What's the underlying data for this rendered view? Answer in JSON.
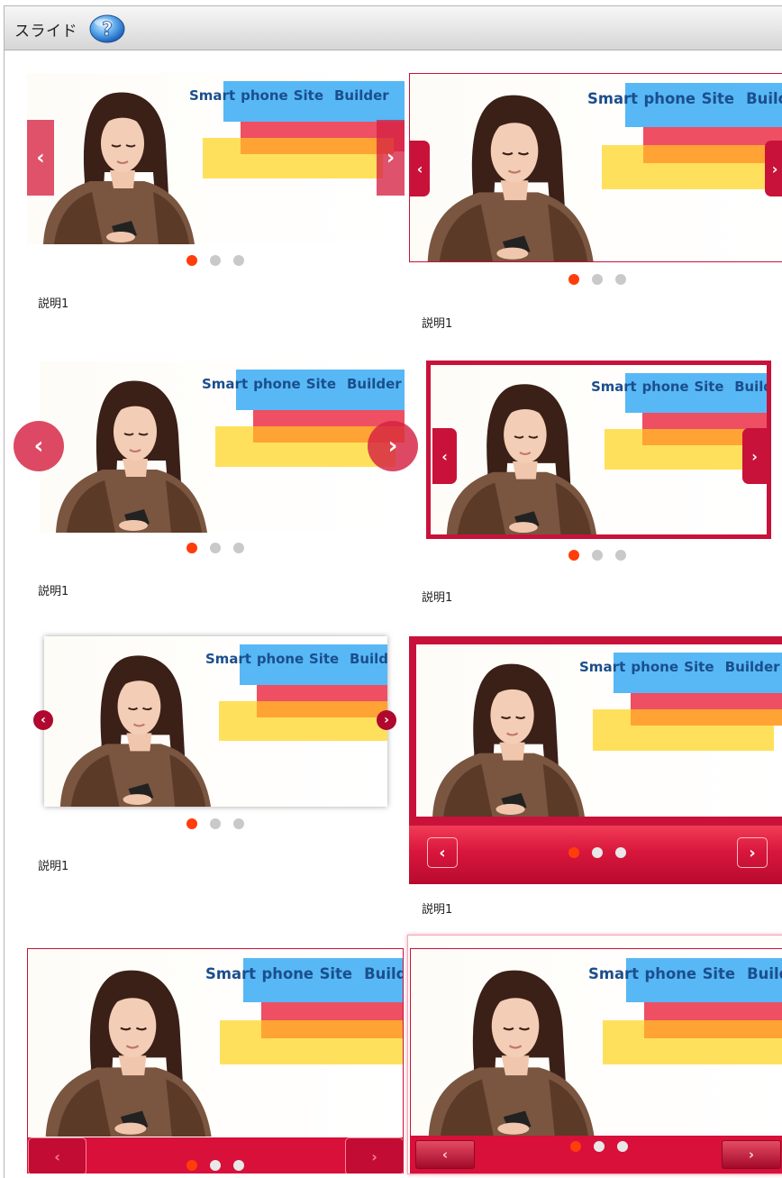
{
  "header": {
    "title": "スライド"
  },
  "slide_brand": {
    "w1": "Smart",
    "w2": "phone",
    "w3": "Site",
    "w4": "Builder"
  },
  "slides": [
    {
      "caption": "説明1",
      "active_dot": 1,
      "dot_count": 3,
      "prev_label": "‹",
      "next_label": "›"
    },
    {
      "caption": "説明1",
      "active_dot": 1,
      "dot_count": 3,
      "prev_label": "‹",
      "next_label": "›"
    },
    {
      "caption": "説明1",
      "active_dot": 1,
      "dot_count": 3,
      "prev_label": "‹",
      "next_label": "›"
    },
    {
      "caption": "説明1",
      "active_dot": 1,
      "dot_count": 3,
      "prev_label": "‹",
      "next_label": "›"
    },
    {
      "caption": "説明1",
      "active_dot": 1,
      "dot_count": 3,
      "prev_label": "‹",
      "next_label": "›"
    },
    {
      "caption": "説明1",
      "active_dot": 1,
      "dot_count": 3,
      "prev_label": "‹",
      "next_label": "›"
    },
    {
      "caption": "",
      "active_dot": 1,
      "dot_count": 3,
      "prev_label": "‹",
      "next_label": "›"
    },
    {
      "caption": "",
      "active_dot": 1,
      "dot_count": 3,
      "prev_label": "‹",
      "next_label": "›"
    }
  ],
  "colors": {
    "accent": "#d4113a",
    "dot_active": "#ff3d0b",
    "dot_inactive": "#c9c9c9"
  },
  "icons": {
    "help": "help-question-icon",
    "prev": "chevron-left-icon",
    "next": "chevron-right-icon"
  }
}
